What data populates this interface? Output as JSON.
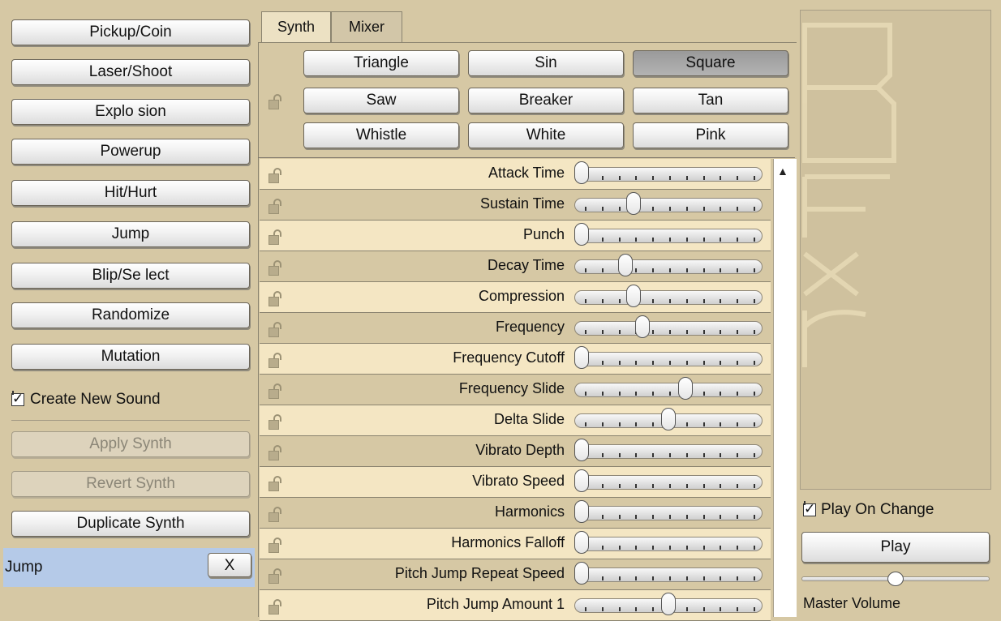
{
  "left": {
    "buttons": [
      "Pickup/Coin",
      "Laser/Shoot",
      "Explo sion",
      "Powerup",
      "Hit/Hurt",
      "Jump",
      "Blip/Se lect",
      "Randomize",
      "Mutation"
    ],
    "create_new_sound": {
      "label": "Create New Sound",
      "checked": true
    },
    "apply_synth": "Apply Synth",
    "revert_synth": "Revert Synth",
    "duplicate_synth": "Duplicate Synth",
    "selected_item": {
      "name": "Jump",
      "remove_label": "X"
    }
  },
  "tabs": [
    "Synth",
    "Mixer"
  ],
  "waveforms": {
    "buttons": [
      "Triangle",
      "Sin",
      "Square",
      "Saw",
      "Breaker",
      "Tan",
      "Whistle",
      "White",
      "Pink"
    ],
    "selected": "Square"
  },
  "params": [
    {
      "label": "Attack Time",
      "value": 0.0
    },
    {
      "label": "Sustain Time",
      "value": 0.3
    },
    {
      "label": "Punch",
      "value": 0.0
    },
    {
      "label": "Decay Time",
      "value": 0.25
    },
    {
      "label": "Compression",
      "value": 0.3
    },
    {
      "label": "Frequency",
      "value": 0.35
    },
    {
      "label": "Frequency Cutoff",
      "value": 0.0
    },
    {
      "label": "Frequency Slide",
      "value": 0.6
    },
    {
      "label": "Delta Slide",
      "value": 0.5
    },
    {
      "label": "Vibrato Depth",
      "value": 0.0
    },
    {
      "label": "Vibrato Speed",
      "value": 0.0
    },
    {
      "label": "Harmonics",
      "value": 0.0
    },
    {
      "label": "Harmonics Falloff",
      "value": 0.0
    },
    {
      "label": "Pitch Jump Repeat Speed",
      "value": 0.0
    },
    {
      "label": "Pitch Jump Amount 1",
      "value": 0.5
    }
  ],
  "right": {
    "logo_text": "Bfxr",
    "play_on_change": {
      "label": "Play On Change",
      "checked": true
    },
    "play": "Play",
    "master_volume": {
      "label": "Master Volume",
      "value": 0.5
    }
  },
  "colors": {
    "accent": "#d6c8a4",
    "row_light": "#f4e6c3",
    "selected_bg": "#b5cae8"
  },
  "icons": {
    "lock": "lock-icon",
    "scroll_up": "scroll-up-arrow-icon",
    "check": "checkmark-icon"
  }
}
